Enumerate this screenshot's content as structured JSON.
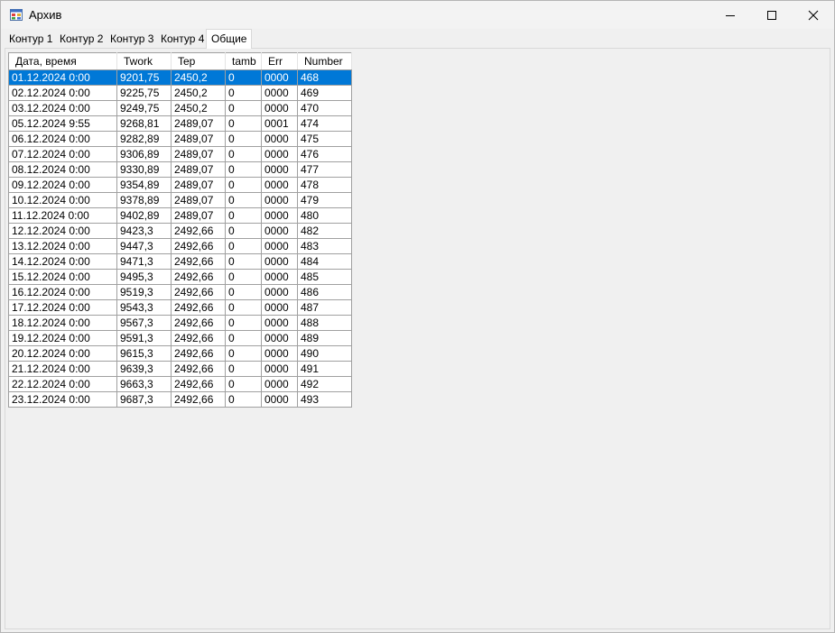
{
  "window": {
    "title": "Архив"
  },
  "tabs": [
    {
      "label": "Контур 1",
      "active": false
    },
    {
      "label": "Контур 2",
      "active": false
    },
    {
      "label": "Контур 3",
      "active": false
    },
    {
      "label": "Контур 4",
      "active": false
    },
    {
      "label": "Общие",
      "active": true
    }
  ],
  "grid": {
    "columns": [
      "Дата, время",
      "Twork",
      "Tep",
      "tamb",
      "Err",
      "Number"
    ],
    "selected_row": 0,
    "rows": [
      [
        "01.12.2024 0:00",
        "9201,75",
        "2450,2",
        "0",
        "0000",
        "468"
      ],
      [
        "02.12.2024 0:00",
        "9225,75",
        "2450,2",
        "0",
        "0000",
        "469"
      ],
      [
        "03.12.2024 0:00",
        "9249,75",
        "2450,2",
        "0",
        "0000",
        "470"
      ],
      [
        "05.12.2024 9:55",
        "9268,81",
        "2489,07",
        "0",
        "0001",
        "474"
      ],
      [
        "06.12.2024 0:00",
        "9282,89",
        "2489,07",
        "0",
        "0000",
        "475"
      ],
      [
        "07.12.2024 0:00",
        "9306,89",
        "2489,07",
        "0",
        "0000",
        "476"
      ],
      [
        "08.12.2024 0:00",
        "9330,89",
        "2489,07",
        "0",
        "0000",
        "477"
      ],
      [
        "09.12.2024 0:00",
        "9354,89",
        "2489,07",
        "0",
        "0000",
        "478"
      ],
      [
        "10.12.2024 0:00",
        "9378,89",
        "2489,07",
        "0",
        "0000",
        "479"
      ],
      [
        "11.12.2024 0:00",
        "9402,89",
        "2489,07",
        "0",
        "0000",
        "480"
      ],
      [
        "12.12.2024 0:00",
        "9423,3",
        "2492,66",
        "0",
        "0000",
        "482"
      ],
      [
        "13.12.2024 0:00",
        "9447,3",
        "2492,66",
        "0",
        "0000",
        "483"
      ],
      [
        "14.12.2024 0:00",
        "9471,3",
        "2492,66",
        "0",
        "0000",
        "484"
      ],
      [
        "15.12.2024 0:00",
        "9495,3",
        "2492,66",
        "0",
        "0000",
        "485"
      ],
      [
        "16.12.2024 0:00",
        "9519,3",
        "2492,66",
        "0",
        "0000",
        "486"
      ],
      [
        "17.12.2024 0:00",
        "9543,3",
        "2492,66",
        "0",
        "0000",
        "487"
      ],
      [
        "18.12.2024 0:00",
        "9567,3",
        "2492,66",
        "0",
        "0000",
        "488"
      ],
      [
        "19.12.2024 0:00",
        "9591,3",
        "2492,66",
        "0",
        "0000",
        "489"
      ],
      [
        "20.12.2024 0:00",
        "9615,3",
        "2492,66",
        "0",
        "0000",
        "490"
      ],
      [
        "21.12.2024 0:00",
        "9639,3",
        "2492,66",
        "0",
        "0000",
        "491"
      ],
      [
        "22.12.2024 0:00",
        "9663,3",
        "2492,66",
        "0",
        "0000",
        "492"
      ],
      [
        "23.12.2024 0:00",
        "9687,3",
        "2492,66",
        "0",
        "0000",
        "493"
      ]
    ]
  },
  "colors": {
    "selection": "#0078d7",
    "window_bg": "#f0f0f0"
  }
}
